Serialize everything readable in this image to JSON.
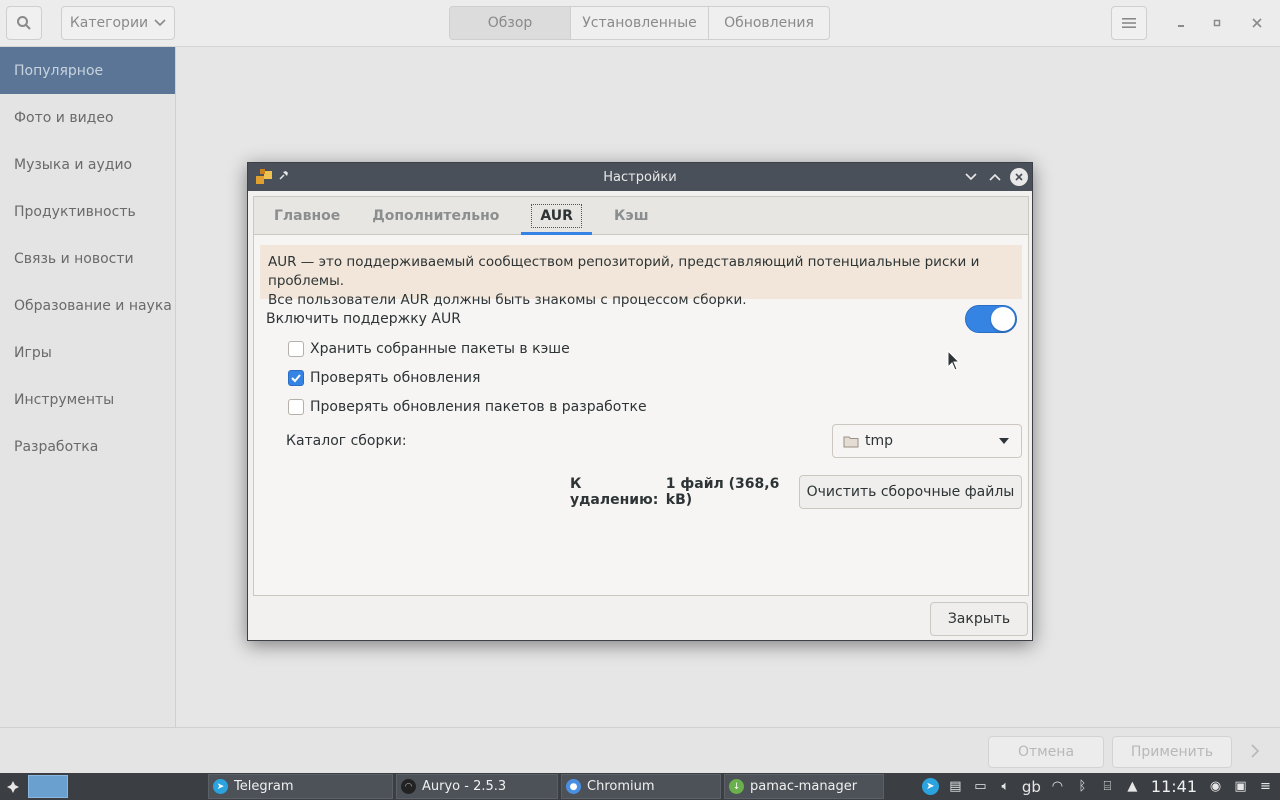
{
  "header": {
    "categories_label": "Категории",
    "tabs": [
      "Обзор",
      "Установленные",
      "Обновления"
    ]
  },
  "sidebar": {
    "items": [
      {
        "label": "Популярное"
      },
      {
        "label": "Фото и видео"
      },
      {
        "label": "Музыка и аудио"
      },
      {
        "label": "Продуктивность"
      },
      {
        "label": "Связь и новости"
      },
      {
        "label": "Образование и наука"
      },
      {
        "label": "Игры"
      },
      {
        "label": "Инструменты"
      },
      {
        "label": "Разработка"
      }
    ]
  },
  "bottom_bar": {
    "cancel_label": "Отмена",
    "apply_label": "Применить"
  },
  "dialog": {
    "title": "Настройки",
    "tabs": [
      "Главное",
      "Дополнительно",
      "AUR",
      "Кэш"
    ],
    "info_line1": "AUR — это поддерживаемый сообществом репозиторий, представляющий потенциальные риски и проблемы.",
    "info_line2": "Все пользователи AUR должны быть знакомы с процессом сборки.",
    "enable_aur_label": "Включить поддержку AUR",
    "enable_aur_on": true,
    "options": [
      {
        "label": "Хранить собранные пакеты в кэше",
        "checked": false
      },
      {
        "label": "Проверять обновления",
        "checked": true
      },
      {
        "label": "Проверять обновления пакетов в разработке",
        "checked": false
      }
    ],
    "build_dir_label": "Каталог сборки:",
    "build_dir_value": "tmp",
    "to_remove_label": "К удалению:",
    "to_remove_value": "1 файл  (368,6 kB)",
    "clean_button": "Очистить сборочные файлы",
    "close_button": "Закрыть"
  },
  "taskbar": {
    "tasks": [
      "Telegram",
      "Auryo - 2.5.3",
      "Chromium",
      "pamac-manager"
    ],
    "keyboard_layout": "gb",
    "clock": "11:41"
  },
  "colors": {
    "accent": "#3584e4",
    "sidebar_active": "#5a7595",
    "info_bg": "#f1e6d9",
    "titlebar": "#4a5059"
  }
}
